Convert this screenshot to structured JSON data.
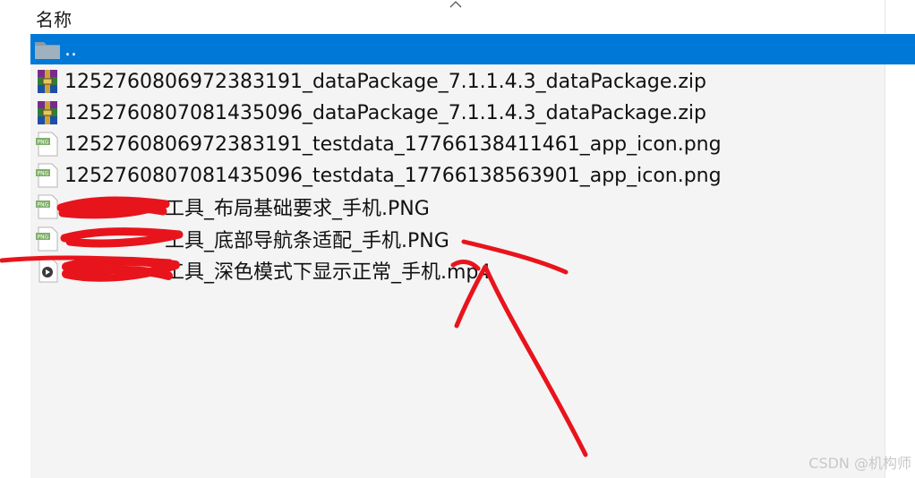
{
  "header": {
    "name_column": "名称"
  },
  "rows": [
    {
      "label": "..",
      "icon": "folder-icon",
      "selected": true
    },
    {
      "label": "1252760806972383191_dataPackage_7.1.1.4.3_dataPackage.zip",
      "icon": "zip-archive-icon"
    },
    {
      "label": "1252760807081435096_dataPackage_7.1.1.4.3_dataPackage.zip",
      "icon": "zip-archive-icon"
    },
    {
      "label": "1252760806972383191_testdata_17766138411461_app_icon.png",
      "icon": "png-file-icon"
    },
    {
      "label": "1252760807081435096_testdata_17766138563901_app_icon.png",
      "icon": "png-file-icon"
    },
    {
      "label": "工具_布局基础要求_手机.PNG",
      "icon": "png-file-icon"
    },
    {
      "label": "工具_底部导航条适配_手机.PNG",
      "icon": "png-file-icon"
    },
    {
      "label": "工具_深色模式下显示正常_手机.mp4",
      "icon": "video-file-icon"
    }
  ],
  "colors": {
    "selection": "#0078d7",
    "list_background": "#f4f4f4",
    "annotation": "#e8141c"
  },
  "watermark": "CSDN @机构师"
}
